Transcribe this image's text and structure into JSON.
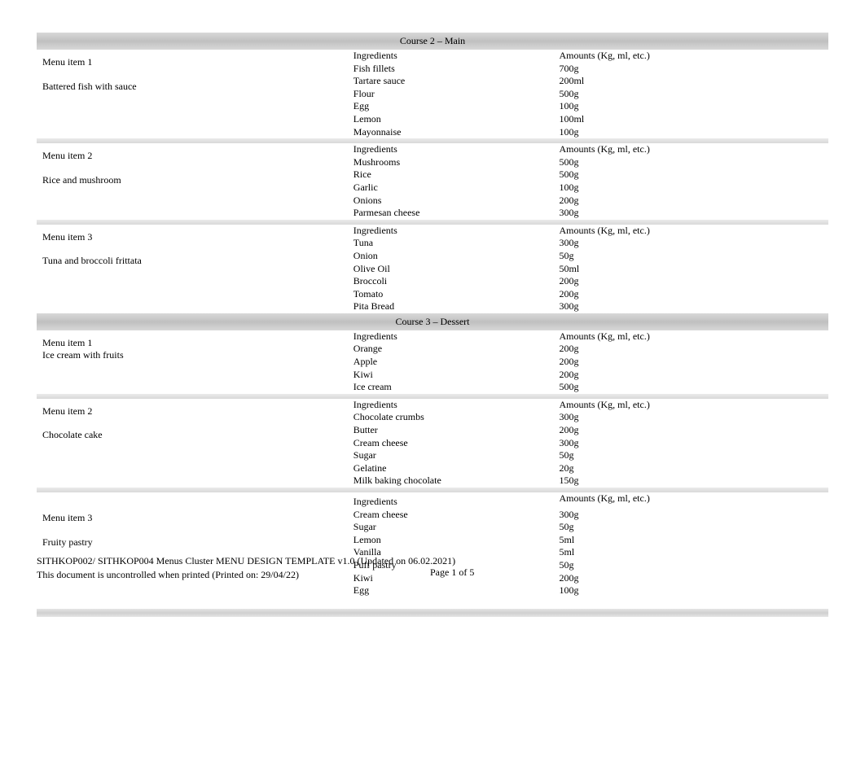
{
  "courses": [
    {
      "title": "Course 2 – Main",
      "items": [
        {
          "label": "Menu item 1",
          "name": "Battered fish with sauce",
          "ing_header": "Ingredients",
          "amt_header": "Amounts (Kg, ml, etc.)",
          "rows": [
            {
              "ing": "Fish fillets",
              "amt": "700g"
            },
            {
              "ing": "Tartare sauce",
              "amt": "200ml"
            },
            {
              "ing": "Flour",
              "amt": "500g"
            },
            {
              "ing": "Egg",
              "amt": "100g"
            },
            {
              "ing": "Lemon",
              "amt": "100ml"
            },
            {
              "ing": "Mayonnaise",
              "amt": "100g"
            }
          ]
        },
        {
          "label": "Menu item 2",
          "name": "Rice and mushroom",
          "ing_header": "Ingredients",
          "amt_header": "Amounts (Kg, ml, etc.)",
          "rows": [
            {
              "ing": "Mushrooms",
              "amt": "500g"
            },
            {
              "ing": "Rice",
              "amt": "500g"
            },
            {
              "ing": "Garlic",
              "amt": "100g"
            },
            {
              "ing": "Onions",
              "amt": "200g"
            },
            {
              "ing": "Parmesan cheese",
              "amt": "300g"
            }
          ]
        },
        {
          "label": "Menu item 3",
          "name": "Tuna and broccoli frittata",
          "ing_header": "Ingredients",
          "amt_header": "Amounts (Kg, ml, etc.)",
          "rows": [
            {
              "ing": "Tuna",
              "amt": "300g"
            },
            {
              "ing": "Onion",
              "amt": "50g"
            },
            {
              "ing": "Olive Oil",
              "amt": "50ml"
            },
            {
              "ing": "Broccoli",
              "amt": "200g"
            },
            {
              "ing": "Tomato",
              "amt": "200g"
            },
            {
              "ing": "Pita Bread",
              "amt": "300g"
            }
          ]
        }
      ]
    },
    {
      "title": "Course 3 – Dessert",
      "items": [
        {
          "label": "Menu item 1",
          "name": "Ice cream with fruits",
          "ing_header": "Ingredients",
          "amt_header": "Amounts (Kg, ml, etc.)",
          "rows": [
            {
              "ing": "Orange",
              "amt": "200g"
            },
            {
              "ing": "Apple",
              "amt": "200g"
            },
            {
              "ing": "Kiwi",
              "amt": "200g"
            },
            {
              "ing": "Ice cream",
              "amt": "500g"
            }
          ]
        },
        {
          "label": "Menu item 2",
          "name": "Chocolate cake",
          "ing_header": "Ingredients",
          "amt_header": "Amounts (Kg, ml, etc.)",
          "rows": [
            {
              "ing": "Chocolate crumbs",
              "amt": "300g"
            },
            {
              "ing": "Butter",
              "amt": "200g"
            },
            {
              "ing": "Cream cheese",
              "amt": "300g"
            },
            {
              "ing": "Sugar",
              "amt": "50g"
            },
            {
              "ing": "Gelatine",
              "amt": "20g"
            },
            {
              "ing": "Milk baking chocolate",
              "amt": "150g"
            }
          ]
        },
        {
          "label": "Menu item 3",
          "name": "Fruity pastry",
          "ing_header": "Ingredients",
          "amt_header": "Amounts (Kg, ml, etc.)",
          "rows": [
            {
              "ing": "Cream cheese",
              "amt": "300g"
            },
            {
              "ing": "Sugar",
              "amt": "50g"
            },
            {
              "ing": "Lemon",
              "amt": "5ml"
            },
            {
              "ing": "Vanilla",
              "amt": "5ml"
            },
            {
              "ing": "Puff pastry",
              "amt": "50g"
            },
            {
              "ing": "Kiwi",
              "amt": "200g"
            },
            {
              "ing": "Egg",
              "amt": "100g"
            }
          ]
        }
      ]
    }
  ],
  "footer": {
    "line1": "SITHKOP002/ SITHKOP004 Menus Cluster MENU DESIGN TEMPLATE v1.0 (Updated on 06.02.2021)",
    "line2": "This document is uncontrolled when printed (Printed on: 29/04/22)",
    "page": "Page 1 of 5"
  }
}
